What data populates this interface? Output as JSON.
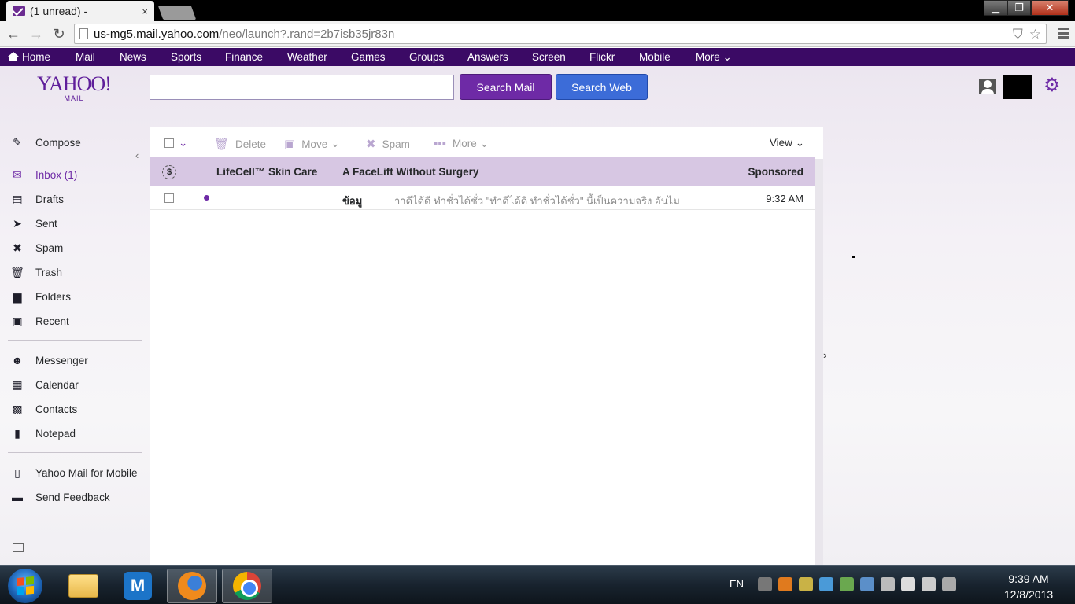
{
  "browser": {
    "tab_title": "(1 unread) -",
    "tab_close": "×",
    "url_host": "us-mg5.mail.yahoo.com",
    "url_path": "/neo/launch?.rand=2b7isb35jr83n",
    "back_glyph": "←",
    "forward_glyph": "→",
    "reload_glyph": "↻",
    "shield_glyph": "⛉",
    "star_glyph": "☆",
    "minimize_glyph": "▁",
    "maximize_glyph": "❐",
    "close_glyph": "✕"
  },
  "yahoo_nav": {
    "items": [
      "Home",
      "Mail",
      "News",
      "Sports",
      "Finance",
      "Weather",
      "Games",
      "Groups",
      "Answers",
      "Screen",
      "Flickr",
      "Mobile",
      "More"
    ],
    "more_caret": "⌄"
  },
  "header": {
    "logo_text": "YAHOO!",
    "logo_sub": "MAIL",
    "search_placeholder": "",
    "search_mail_label": "Search Mail",
    "search_web_label": "Search Web",
    "gear_glyph": "⚙"
  },
  "sidebar": {
    "collapse_glyph": "‹",
    "items": [
      {
        "label": "Compose",
        "icon": "compose-icon",
        "glyph": "✎"
      },
      {
        "label": "Inbox (1)",
        "icon": "inbox-icon",
        "glyph": "✉",
        "active": true
      },
      {
        "label": "Drafts",
        "icon": "drafts-icon",
        "glyph": "▤"
      },
      {
        "label": "Sent",
        "icon": "sent-icon",
        "glyph": "➤"
      },
      {
        "label": "Spam",
        "icon": "spam-icon",
        "glyph": "✖"
      },
      {
        "label": "Trash",
        "icon": "trash-icon",
        "glyph": "🗑"
      },
      {
        "label": "Folders",
        "icon": "folders-icon",
        "glyph": "▆"
      },
      {
        "label": "Recent",
        "icon": "recent-icon",
        "glyph": "▣"
      },
      {
        "label": "Messenger",
        "icon": "messenger-icon",
        "glyph": "☻"
      },
      {
        "label": "Calendar",
        "icon": "calendar-icon",
        "glyph": "▦"
      },
      {
        "label": "Contacts",
        "icon": "contacts-icon",
        "glyph": "▩"
      },
      {
        "label": "Notepad",
        "icon": "notepad-icon",
        "glyph": "▮"
      },
      {
        "label": "Yahoo Mail for Mobile",
        "icon": "mobile-icon",
        "glyph": "▯"
      },
      {
        "label": "Send Feedback",
        "icon": "feedback-icon",
        "glyph": "▬"
      }
    ]
  },
  "toolbar": {
    "select_caret": "⌄",
    "delete_label": "Delete",
    "move_label": "Move",
    "spam_label": "Spam",
    "more_label": "More",
    "view_label": "View",
    "caret": "⌄"
  },
  "messages": {
    "ad": {
      "badge": "$",
      "sender": "LifeCell™ Skin Care",
      "subject": "A FaceLift Without Surgery",
      "tag": "Sponsored"
    },
    "rows": [
      {
        "sender": "",
        "subject": "ข้อมู",
        "preview": "ำาดีได้ดี ทำชั่วได้ชั่ว \"ทำดีได้ดี ทำชั่วได้ชั่ว\" นี้เป็นความจริง อันไม",
        "time": "9:32 AM",
        "unread": true
      }
    ],
    "expand_glyph": "›"
  },
  "taskbar": {
    "language": "EN",
    "time": "9:39 AM",
    "date": "12/8/2013",
    "maxthon_letter": "M"
  },
  "colors": {
    "yahoo_purple": "#6e2aa6",
    "nav_bg": "#3b0a65",
    "ad_row_bg": "#d7c7e3",
    "search_web_blue": "#3c6cd8"
  }
}
